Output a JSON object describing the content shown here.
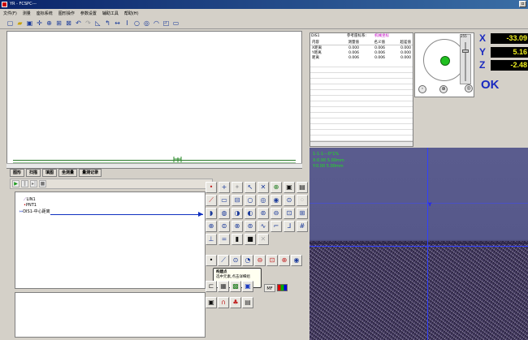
{
  "window": {
    "title": "YR - FCSPC---"
  },
  "menu": [
    "文件(F)",
    "测量",
    "座标系统",
    "图形操作",
    "参数设置",
    "辅助工具",
    "帮助(H)"
  ],
  "toolbar_icons": [
    "new-file-icon",
    "open-folder-icon",
    "save-icon",
    "crosshair-icon",
    "zoom-icon",
    "grid-icon",
    "fit-icon",
    "undo-icon",
    "redo-icon",
    "line-tool-icon",
    "arc-tool-icon",
    "distance-icon",
    "angle-icon",
    "circle-icon",
    "ellipse-icon",
    "curve-icon",
    "rectangle-icon",
    "window-icon"
  ],
  "tabs": [
    "图形",
    "扫描",
    "填图",
    "坐测量",
    "量测记录"
  ],
  "tree": {
    "items": [
      "LIN1",
      "PNT1",
      "DIS1-中心距离"
    ]
  },
  "data_panel": {
    "id": "DIS1",
    "ref_label": "参考座标系:",
    "ref_value": "机械坐标",
    "columns": [
      "内容",
      "测量值",
      "名义值",
      "超差值"
    ],
    "rows": [
      {
        "name": "X距离",
        "measured": "0.000",
        "nominal": "0.006",
        "dev": "0.000"
      },
      {
        "name": "Y距离",
        "measured": "0.006",
        "nominal": "0.006",
        "dev": "0.000"
      },
      {
        "name": "距离",
        "measured": "0.006",
        "nominal": "0.006",
        "dev": "0.000"
      }
    ]
  },
  "dial": {
    "slider_value": "255"
  },
  "readout": {
    "x_label": "X",
    "x_value": "-33.09",
    "y_label": "Y",
    "y_value": "5.16",
    "z_label": "Z",
    "z_value": "-2.48",
    "status": "OK"
  },
  "camera": {
    "line1": "1-1-1---0°1%",
    "line2": "X:0.00 5.00mm",
    "line3": "Y:0.00 5.00mm",
    "marker": "Y"
  },
  "tooltip": {
    "title": "构建点",
    "desc": "选中元素,点击详细组"
  },
  "tool_buttons": {
    "mf": "MF"
  },
  "colors": {
    "title_bar": "#0a246a",
    "readout_text": "#f0f020",
    "axis_label": "#1a2ac0",
    "ok": "#1a2ac0",
    "dial_dot": "#20c020"
  }
}
